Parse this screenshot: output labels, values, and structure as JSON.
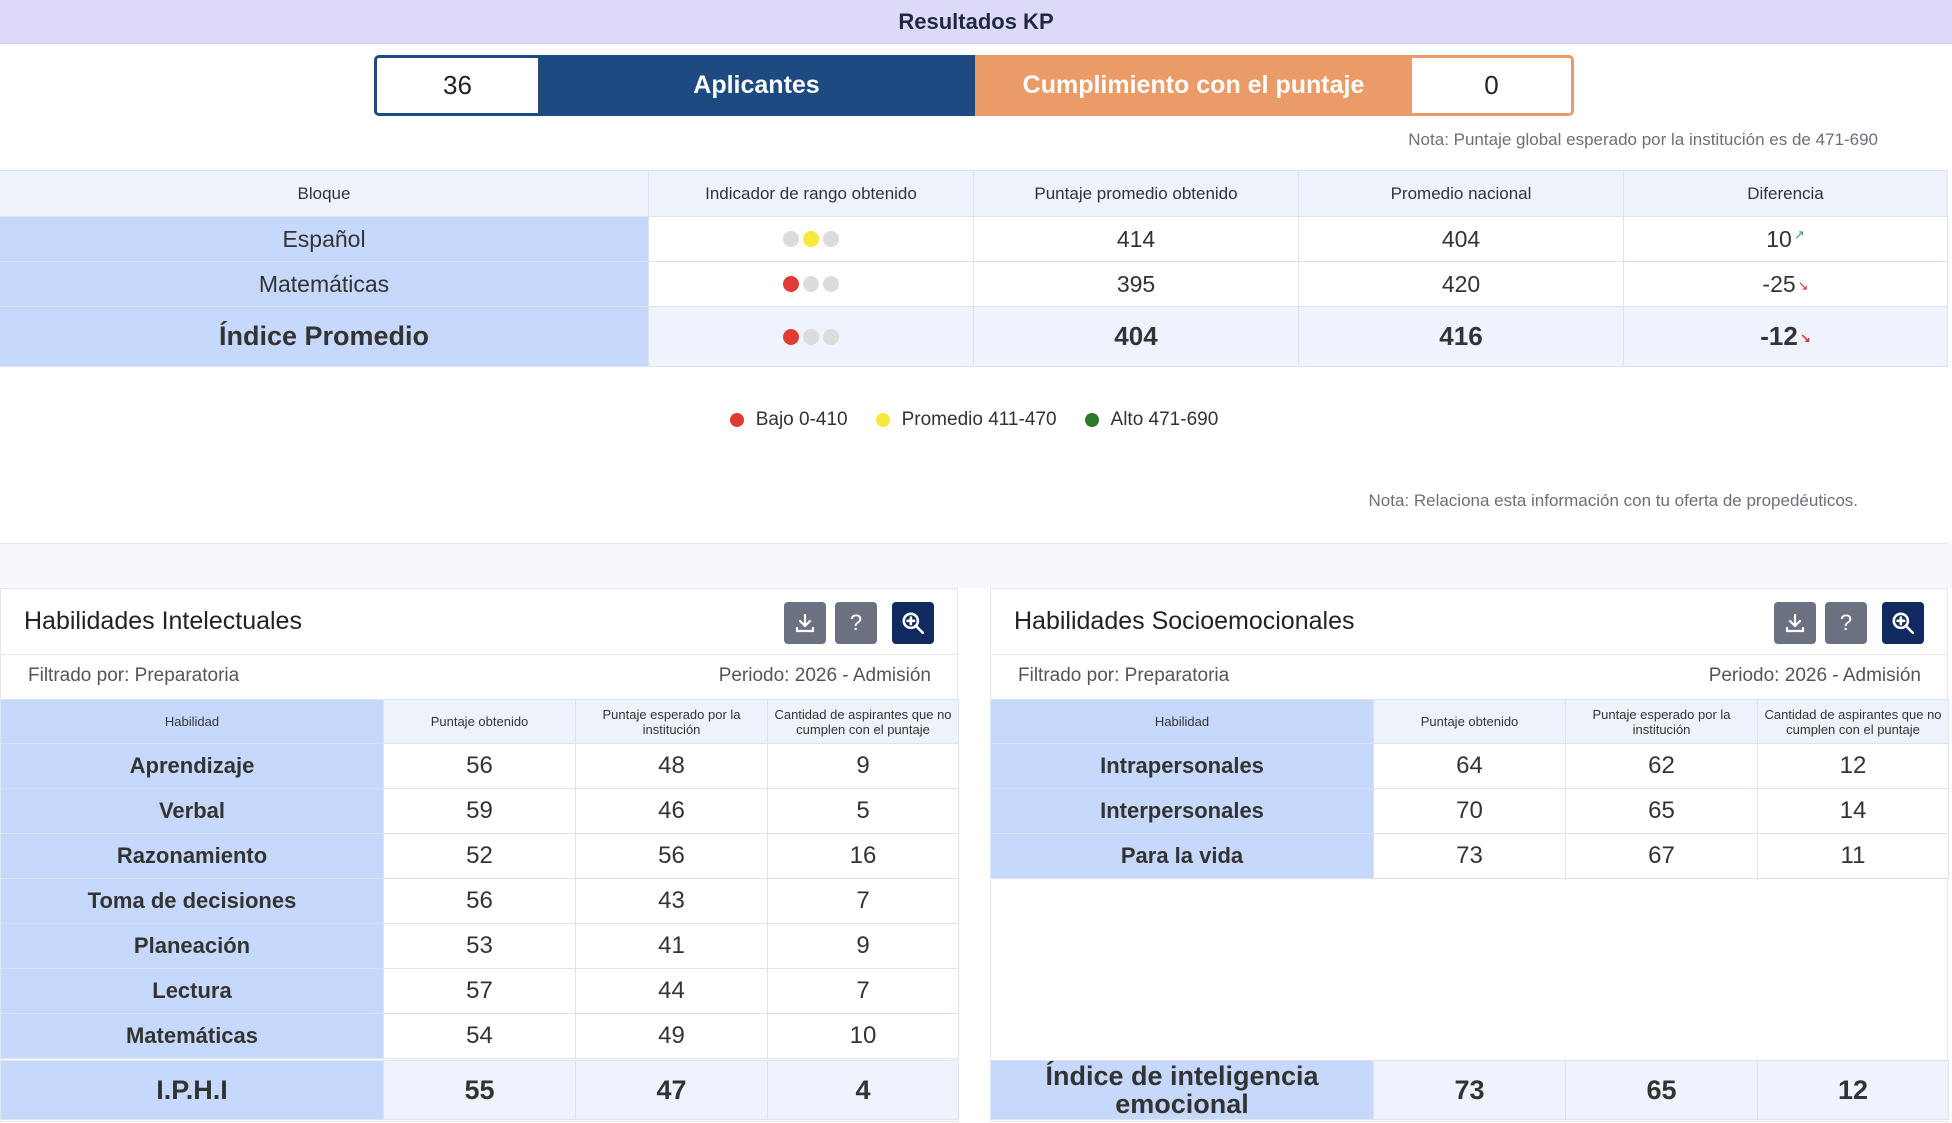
{
  "title": "Resultados KP",
  "summary": {
    "applicants_count": "36",
    "applicants_label": "Aplicantes",
    "compliance_label": "Cumplimiento con el puntaje",
    "compliance_count": "0"
  },
  "note_expected": "Nota: Puntaje global esperado por la institución es de 471-690",
  "results": {
    "headers": [
      "Bloque",
      "Indicador de rango obtenido",
      "Puntaje promedio obtenido",
      "Promedio nacional",
      "Diferencia"
    ],
    "rows": [
      {
        "bloque": "Español",
        "indicator": "yellow",
        "puntaje": "414",
        "nacional": "404",
        "diferencia": "10",
        "trend": "up"
      },
      {
        "bloque": "Matemáticas",
        "indicator": "red",
        "puntaje": "395",
        "nacional": "420",
        "diferencia": "-25",
        "trend": "down"
      },
      {
        "bloque": "Índice Promedio",
        "indicator": "red",
        "puntaje": "404",
        "nacional": "416",
        "diferencia": "-12",
        "trend": "down"
      }
    ]
  },
  "legend": [
    {
      "label": "Bajo 0-410",
      "color": "#e13b35"
    },
    {
      "label": "Promedio 411-470",
      "color": "#f5ea3a"
    },
    {
      "label": "Alto 471-690",
      "color": "#2e7a27"
    }
  ],
  "note_propedeuticos": "Nota: Relaciona esta información con tu oferta de propedéuticos.",
  "intellectual": {
    "title": "Habilidades Intelectuales",
    "filter_label": "Filtrado por:",
    "filter_value": "Preparatoria",
    "period_label": "Periodo:",
    "period_value": "2026 - Admisión",
    "headers": [
      "Habilidad",
      "Puntaje obtenido",
      "Puntaje esperado por la institución",
      "Cantidad de aspirantes que no cumplen con el puntaje"
    ],
    "rows": [
      [
        "Aprendizaje",
        "56",
        "48",
        "9"
      ],
      [
        "Verbal",
        "59",
        "46",
        "5"
      ],
      [
        "Razonamiento",
        "52",
        "56",
        "16"
      ],
      [
        "Toma de decisiones",
        "56",
        "43",
        "7"
      ],
      [
        "Planeación",
        "53",
        "41",
        "9"
      ],
      [
        "Lectura",
        "57",
        "44",
        "7"
      ],
      [
        "Matemáticas",
        "54",
        "49",
        "10"
      ]
    ],
    "summary": [
      "I.P.H.I",
      "55",
      "47",
      "4"
    ]
  },
  "socio": {
    "title": "Habilidades Socioemocionales",
    "filter_label": "Filtrado por:",
    "filter_value": "Preparatoria",
    "period_label": "Periodo:",
    "period_value": "2026 - Admisión",
    "headers": [
      "Habilidad",
      "Puntaje obtenido",
      "Puntaje esperado por la institución",
      "Cantidad de aspirantes que no cumplen con el puntaje"
    ],
    "rows": [
      [
        "Intrapersonales",
        "64",
        "62",
        "12"
      ],
      [
        "Interpersonales",
        "70",
        "65",
        "14"
      ],
      [
        "Para la vida",
        "73",
        "67",
        "11"
      ]
    ],
    "summary": [
      "Índice de inteligencia emocional",
      "73",
      "65",
      "12"
    ]
  },
  "toolbar_icons": [
    "download-icon",
    "help-icon",
    "zoom-in-icon"
  ],
  "colors": {
    "titlebar": "#dcdaf8",
    "applicants": "#1d4a80",
    "compliance": "#ea9b67",
    "row_highlight": "#c6d8fb"
  }
}
